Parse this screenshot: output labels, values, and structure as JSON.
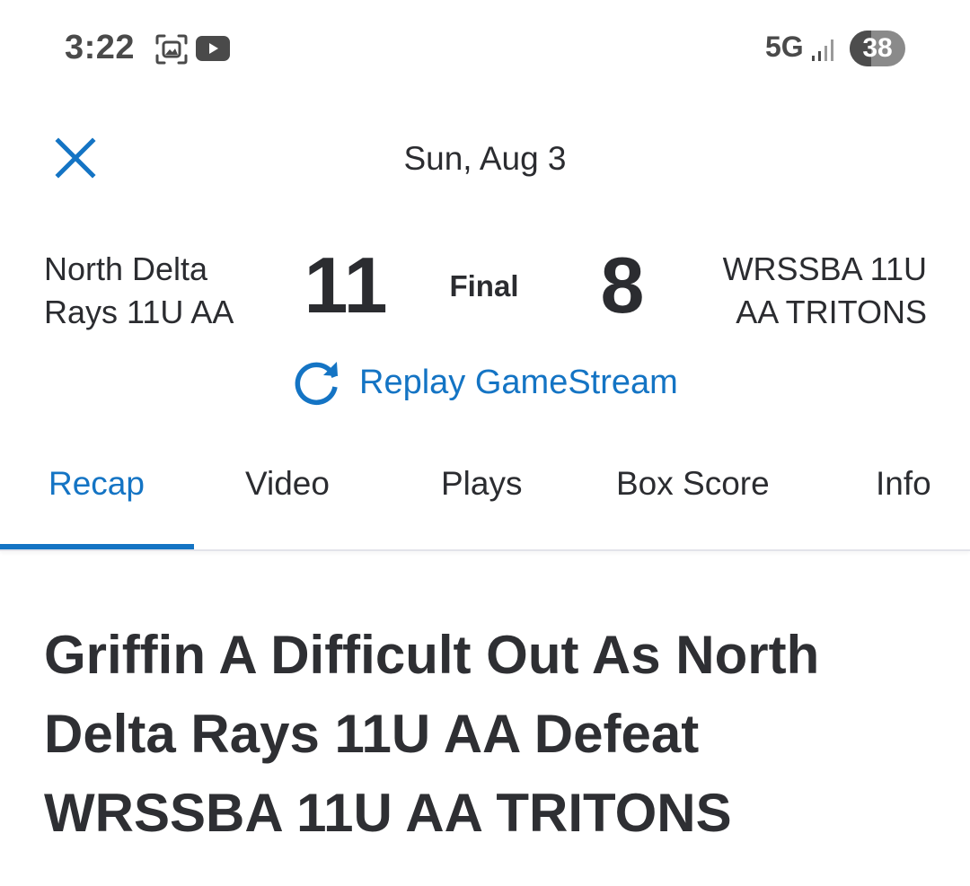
{
  "status_bar": {
    "time": "3:22",
    "network": "5G",
    "battery_level": "38",
    "battery_fraction": 0.38
  },
  "header": {
    "date": "Sun, Aug 3"
  },
  "game": {
    "home_team": "North Delta Rays 11U AA",
    "home_score": "11",
    "status": "Final",
    "away_score": "8",
    "away_team": "WRSSBA 11U AA TRITONS"
  },
  "replay": {
    "label": "Replay GameStream"
  },
  "tabs": [
    {
      "label": "Recap"
    },
    {
      "label": "Video"
    },
    {
      "label": "Plays"
    },
    {
      "label": "Box Score"
    },
    {
      "label": "Info"
    }
  ],
  "article": {
    "headline": "Griffin A Difficult Out As North Delta Rays 11U AA Defeat WRSSBA 11U AA TRITONS"
  },
  "icons": {
    "close": "close-icon",
    "replay": "replay-icon",
    "screenshot": "screenshot-icon",
    "youtube": "youtube-icon",
    "signal": "signal-icon"
  },
  "colors": {
    "accent": "#1474c4",
    "text": "#2b2c30"
  }
}
